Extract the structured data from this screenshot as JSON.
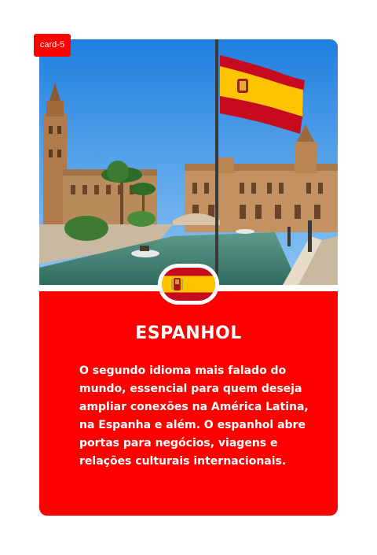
{
  "card": {
    "tag": "card-5",
    "title": "ESPANHOL",
    "description": "O segundo idioma mais falado do mundo, essencial para quem deseja ampliar conexões na América Latina, na Espanha e além. O espanhol abre portas para negócios, viagens e relações culturais internacionais.",
    "flag_icon": "spain-flag-icon",
    "image": "plaza-de-espana-sevilla-photo"
  },
  "colors": {
    "card_background": "#ff0000",
    "text": "#ffffff",
    "flag_red": "#c60b1e",
    "flag_yellow": "#ffc400"
  }
}
